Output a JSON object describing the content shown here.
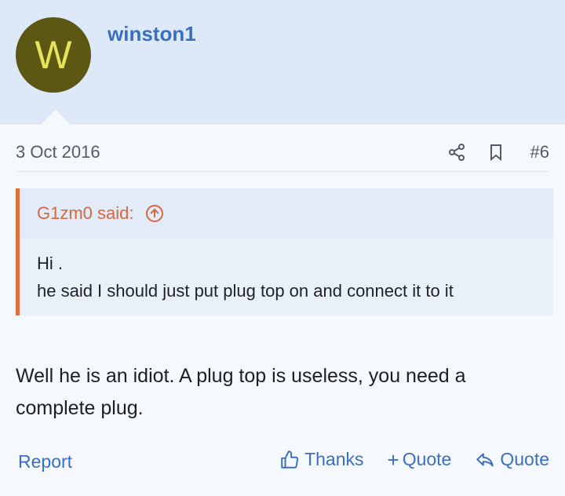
{
  "post": {
    "username": "winston1",
    "avatar_letter": "W",
    "avatar_color": "#5d5714",
    "date": "3 Oct 2016",
    "post_number": "#6",
    "quote": {
      "author_label": "G1zm0 said:",
      "lines": [
        "Hi .",
        "he said I should just put plug top on and connect it to it"
      ]
    },
    "message": "Well he is an idiot. A plug top is useless, you need a complete plug.",
    "actions": {
      "report": "Report",
      "thanks": "Thanks",
      "multiquote": "Quote",
      "quote": "Quote"
    },
    "icons": [
      "share-icon",
      "bookmark-icon",
      "jump-to-quote-icon",
      "thumbs-up-icon",
      "plus-icon",
      "reply-icon"
    ],
    "colors": {
      "accent": "#3a6fbf",
      "quote_accent": "#e0703e",
      "header_bg": "#dde9f8"
    }
  }
}
